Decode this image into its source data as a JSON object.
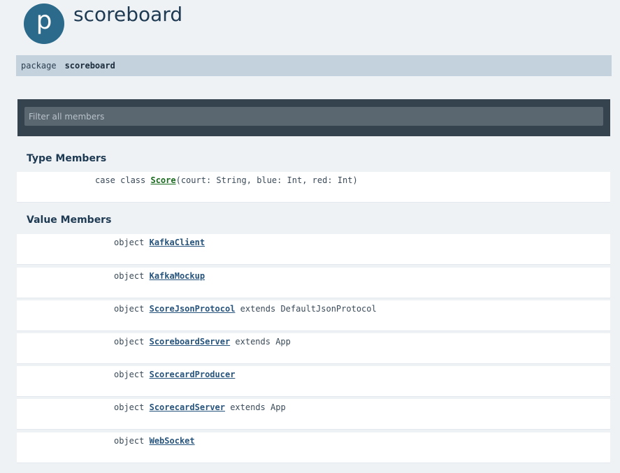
{
  "header": {
    "logo_letter": "p",
    "title": "scoreboard"
  },
  "package_bar": {
    "keyword": "package",
    "name": "scoreboard"
  },
  "filter": {
    "placeholder": "Filter all members"
  },
  "type_members": {
    "heading": "Type Members",
    "items": [
      {
        "kind": "case class",
        "name": "Score",
        "params": "(court: String, blue: Int, red: Int)"
      }
    ]
  },
  "value_members": {
    "heading": "Value Members",
    "items": [
      {
        "kind": "object",
        "name": "KafkaClient",
        "suffix": ""
      },
      {
        "kind": "object",
        "name": "KafkaMockup",
        "suffix": ""
      },
      {
        "kind": "object",
        "name": "ScoreJsonProtocol",
        "suffix": " extends DefaultJsonProtocol"
      },
      {
        "kind": "object",
        "name": "ScoreboardServer",
        "suffix": " extends App"
      },
      {
        "kind": "object",
        "name": "ScorecardProducer",
        "suffix": ""
      },
      {
        "kind": "object",
        "name": "ScorecardServer",
        "suffix": " extends App"
      },
      {
        "kind": "object",
        "name": "WebSocket",
        "suffix": ""
      }
    ]
  }
}
